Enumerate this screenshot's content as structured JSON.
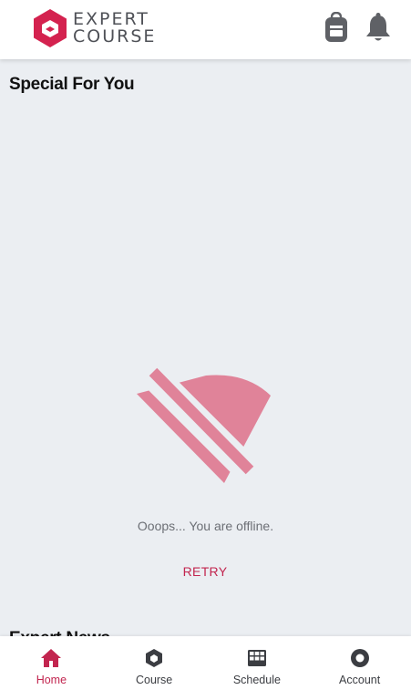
{
  "header": {
    "logo_line1": "EXPERT",
    "logo_line2": "COURSE",
    "brand_color": "#d4224f",
    "icons": [
      "backpack-icon",
      "bell-icon"
    ]
  },
  "main": {
    "section_title": "Special For You",
    "offline_message": "Ooops... You are offline.",
    "retry_label": "RETRY",
    "next_section_title": "Expert News",
    "offline_icon": "wifi-off-icon",
    "offline_icon_color": "#e08399"
  },
  "nav": {
    "active_color": "#c2254f",
    "items": [
      {
        "label": "Home",
        "icon": "home-icon",
        "active": true
      },
      {
        "label": "Course",
        "icon": "hexagon-icon",
        "active": false
      },
      {
        "label": "Schedule",
        "icon": "calendar-icon",
        "active": false
      },
      {
        "label": "Account",
        "icon": "account-icon",
        "active": false
      }
    ]
  }
}
